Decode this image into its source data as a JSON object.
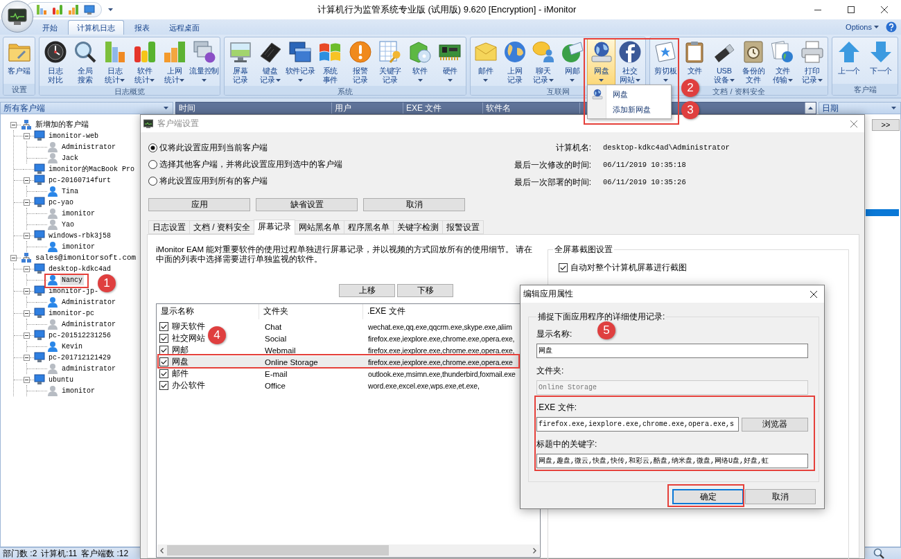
{
  "window": {
    "title": "计算机行为监管系统专业版 (试用版) 9.620 [Encryption] - iMonitor"
  },
  "ribbon": {
    "tabs": [
      {
        "label": "开始",
        "selected": false
      },
      {
        "label": "计算机日志",
        "selected": true
      },
      {
        "label": "报表",
        "selected": false
      },
      {
        "label": "远程桌面",
        "selected": false
      }
    ],
    "options": "Options",
    "groups": [
      {
        "label": "设置",
        "buttons": [
          {
            "lines": [
              "客户端"
            ],
            "dropdown": false,
            "pressed": false
          }
        ]
      },
      {
        "label": "日志概览",
        "buttons": [
          {
            "lines": [
              "日志",
              "对比"
            ],
            "dropdown": false,
            "pressed": false
          },
          {
            "lines": [
              "全局",
              "搜索"
            ],
            "dropdown": false,
            "pressed": false
          },
          {
            "lines": [
              "日志",
              "统计"
            ],
            "dropdown": true,
            "pressed": false
          },
          {
            "lines": [
              "软件",
              "统计"
            ],
            "dropdown": true,
            "pressed": false
          },
          {
            "lines": [
              "上网",
              "统计"
            ],
            "dropdown": true,
            "pressed": false
          },
          {
            "lines": [
              "流量控制"
            ],
            "dropdown": true,
            "pressed": false
          }
        ]
      },
      {
        "label": "系统",
        "buttons": [
          {
            "lines": [
              "屏幕",
              "记录"
            ],
            "dropdown": false,
            "pressed": false
          },
          {
            "lines": [
              "键盘",
              "记录"
            ],
            "dropdown": true,
            "pressed": false
          },
          {
            "lines": [
              "软件记录"
            ],
            "dropdown": true,
            "pressed": false
          },
          {
            "lines": [
              "系统",
              "事件"
            ],
            "dropdown": false,
            "pressed": false
          },
          {
            "lines": [
              "报警",
              "记录"
            ],
            "dropdown": false,
            "pressed": false
          },
          {
            "lines": [
              "关键字",
              "记录"
            ],
            "dropdown": false,
            "pressed": false
          },
          {
            "lines": [
              "软件"
            ],
            "dropdown": true,
            "pressed": false
          },
          {
            "lines": [
              "硬件"
            ],
            "dropdown": true,
            "pressed": false
          }
        ]
      },
      {
        "label": "互联网",
        "buttons": [
          {
            "lines": [
              "邮件"
            ],
            "dropdown": true,
            "pressed": false
          },
          {
            "lines": [
              "上网",
              "记录"
            ],
            "dropdown": false,
            "pressed": false
          },
          {
            "lines": [
              "聊天",
              "记录"
            ],
            "dropdown": true,
            "pressed": false
          },
          {
            "lines": [
              "网邮"
            ],
            "dropdown": true,
            "pressed": false
          },
          {
            "lines": [
              "网盘"
            ],
            "dropdown": true,
            "pressed": true
          },
          {
            "lines": [
              "社交",
              "网站"
            ],
            "dropdown": true,
            "pressed": false
          }
        ]
      },
      {
        "label": "文档 / 资料安全",
        "buttons": [
          {
            "lines": [
              "剪切板"
            ],
            "dropdown": true,
            "pressed": false
          },
          {
            "lines": [
              "文件"
            ],
            "dropdown": false,
            "pressed": false
          },
          {
            "lines": [
              "USB",
              "设备"
            ],
            "dropdown": true,
            "pressed": false
          },
          {
            "lines": [
              "备份的",
              "文件"
            ],
            "dropdown": false,
            "pressed": false
          },
          {
            "lines": [
              "文件",
              "传输"
            ],
            "dropdown": true,
            "pressed": false
          },
          {
            "lines": [
              "打印",
              "记录"
            ],
            "dropdown": true,
            "pressed": false
          }
        ]
      },
      {
        "label": "客户端",
        "buttons": [
          {
            "lines": [
              "上一个"
            ],
            "dropdown": false,
            "pressed": false
          },
          {
            "lines": [
              "下一个"
            ],
            "dropdown": false,
            "pressed": false
          }
        ]
      }
    ]
  },
  "dropdown_menu": {
    "items": [
      {
        "label": "网盘",
        "kind": "icon"
      },
      {
        "label": "添加新网盘",
        "kind": "text"
      }
    ]
  },
  "client_panel": {
    "header": "所有客户端",
    "tree": [
      {
        "label": "新增加的客户端",
        "kind": "group",
        "expanded": true,
        "selected": false,
        "children": [
          {
            "label": "imonitor-web",
            "kind": "computer",
            "expanded": true,
            "selected": false,
            "children": [
              {
                "label": "Administrator",
                "kind": "user",
                "online": false,
                "selected": false
              },
              {
                "label": "Jack",
                "kind": "user",
                "online": false,
                "selected": false
              }
            ]
          },
          {
            "label": "imonitor的MacBook Pro",
            "kind": "computer",
            "selected": false
          },
          {
            "label": "pc-20160714furt",
            "kind": "computer",
            "expanded": true,
            "selected": false,
            "children": [
              {
                "label": "Tina",
                "kind": "user",
                "online": true,
                "selected": false
              }
            ]
          },
          {
            "label": "pc-yao",
            "kind": "computer",
            "expanded": true,
            "selected": false,
            "children": [
              {
                "label": "imonitor",
                "kind": "user",
                "online": false,
                "selected": false
              },
              {
                "label": "Yao",
                "kind": "user",
                "online": false,
                "selected": false
              }
            ]
          },
          {
            "label": "windows-rbk3j58",
            "kind": "computer",
            "expanded": true,
            "selected": false,
            "children": [
              {
                "label": "imonitor",
                "kind": "user",
                "online": true,
                "selected": false
              }
            ]
          }
        ]
      },
      {
        "label": "sales@imonitorsoft.com",
        "kind": "group",
        "expanded": true,
        "selected": false,
        "children": [
          {
            "label": "desktop-kdkc4ad",
            "kind": "computer",
            "expanded": true,
            "selected": false,
            "children": [
              {
                "label": "Nancy",
                "kind": "user",
                "online": true,
                "selected": true
              }
            ]
          },
          {
            "label": "imonitor-jp-",
            "kind": "computer",
            "expanded": true,
            "selected": false,
            "children": [
              {
                "label": "Administrator",
                "kind": "user",
                "online": true,
                "selected": false
              }
            ]
          },
          {
            "label": "imonitor-pc",
            "kind": "computer",
            "expanded": true,
            "selected": false,
            "children": [
              {
                "label": "Administrator",
                "kind": "user",
                "online": false,
                "selected": false
              }
            ]
          },
          {
            "label": "pc-201512231256",
            "kind": "computer",
            "expanded": true,
            "selected": false,
            "children": [
              {
                "label": "Kevin",
                "kind": "user",
                "online": true,
                "selected": false
              }
            ]
          },
          {
            "label": "pc-201712121429",
            "kind": "computer",
            "expanded": true,
            "selected": false,
            "children": [
              {
                "label": "administrator",
                "kind": "user",
                "online": false,
                "selected": false
              }
            ]
          },
          {
            "label": "ubuntu",
            "kind": "computer",
            "expanded": true,
            "selected": false,
            "children": [
              {
                "label": "imonitor",
                "kind": "user",
                "online": false,
                "selected": false
              }
            ]
          }
        ]
      }
    ]
  },
  "log_table": {
    "columns": [
      "时间",
      "用户",
      "EXE 文件",
      "软件名"
    ]
  },
  "date_panel": {
    "header": "日期",
    "expand_button": ">>"
  },
  "status_bar": {
    "items": [
      "部门数 :2",
      "计算机:11",
      "客户端数 :12"
    ]
  },
  "client_settings_dialog": {
    "title": "客户端设置",
    "scope_options": [
      {
        "label": "仅将此设置应用到当前客户端",
        "selected": true
      },
      {
        "label": "选择其他客户端，并将此设置应用到选中的客户端",
        "selected": false
      },
      {
        "label": "将此设置应用到所有的客户端",
        "selected": false
      }
    ],
    "info": [
      {
        "label": "计算机名:",
        "value": "desktop-kdkc4ad\\Administrator"
      },
      {
        "label": "最后一次修改的时间:",
        "value": "06/11/2019 10:35:18"
      },
      {
        "label": "最后一次部署的时间:",
        "value": "06/11/2019 10:35:26"
      }
    ],
    "buttons": [
      "应用",
      "缺省设置",
      "取消"
    ],
    "tabs": [
      {
        "label": "日志设置",
        "selected": false
      },
      {
        "label": "文档 / 资料安全",
        "selected": false
      },
      {
        "label": "屏幕记录",
        "selected": true
      },
      {
        "label": "网站黑名单",
        "selected": false
      },
      {
        "label": "程序黑名单",
        "selected": false
      },
      {
        "label": "关键字检测",
        "selected": false
      },
      {
        "label": "报警设置",
        "selected": false
      }
    ],
    "description": "iMonitor EAM 能对重要软件的使用过程单独进行屏幕记录，并以视频的方式回放所有的使用细节。 请在中面的列表中选择需要进行单独监视的软件。",
    "move_buttons": [
      "上移",
      "下移"
    ],
    "app_list": {
      "columns": [
        "显示名称",
        "文件夹",
        ".EXE 文件"
      ],
      "rows": [
        {
          "name": "聊天软件",
          "folder": "Chat",
          "exe": "wechat.exe,qq.exe,qqcrm.exe,skype.exe,aliim",
          "checked": true,
          "selected": false
        },
        {
          "name": "社交网站",
          "folder": "Social",
          "exe": "firefox.exe,iexplore.exe,chrome.exe,opera.exe,",
          "checked": true,
          "selected": false
        },
        {
          "name": "网邮",
          "folder": "Webmail",
          "exe": "firefox.exe,iexplore.exe,chrome.exe,opera.exe,",
          "checked": true,
          "selected": false
        },
        {
          "name": "网盘",
          "folder": "Online Storage",
          "exe": "firefox.exe,iexplore.exe,chrome.exe,opera.exe",
          "checked": true,
          "selected": true
        },
        {
          "name": "邮件",
          "folder": "E-mail",
          "exe": "outlook.exe,msimn.exe,thunderbird,foxmail.exe",
          "checked": true,
          "selected": false
        },
        {
          "name": "办公软件",
          "folder": "Office",
          "exe": "word.exe,excel.exe,wps.exe,et.exe,",
          "checked": true,
          "selected": false
        }
      ]
    },
    "screenshot_settings": {
      "title": "全屏幕截图设置",
      "auto_capture": {
        "label": "自动对整个计算机屏幕进行截图",
        "checked": true
      }
    }
  },
  "edit_dialog": {
    "title": "编辑应用属性",
    "group_title": "捕捉下面应用程序的详细使用记录:",
    "fields": [
      {
        "label": "显示名称:",
        "value": "网盘",
        "kind": "text",
        "disabled": false
      },
      {
        "label": "文件夹:",
        "value": "Online Storage",
        "kind": "text",
        "disabled": true
      },
      {
        "label": ".EXE 文件:",
        "value": "firefox.exe,iexplore.exe,chrome.exe,opera.exe,s",
        "kind": "browse",
        "button": "浏览器",
        "disabled": false
      },
      {
        "label": "标题中的关键字:",
        "value": "网盘,趣盘,微云,快盘,快传,和彩云,酷盘,纳米盘,微盘,网络U盘,好盘,虹",
        "kind": "text",
        "disabled": false
      }
    ],
    "buttons": [
      {
        "label": "确定",
        "focused": true
      },
      {
        "label": "取消",
        "focused": false
      }
    ]
  },
  "annotations": {
    "markers": [
      "1",
      "2",
      "3",
      "4",
      "5"
    ]
  }
}
